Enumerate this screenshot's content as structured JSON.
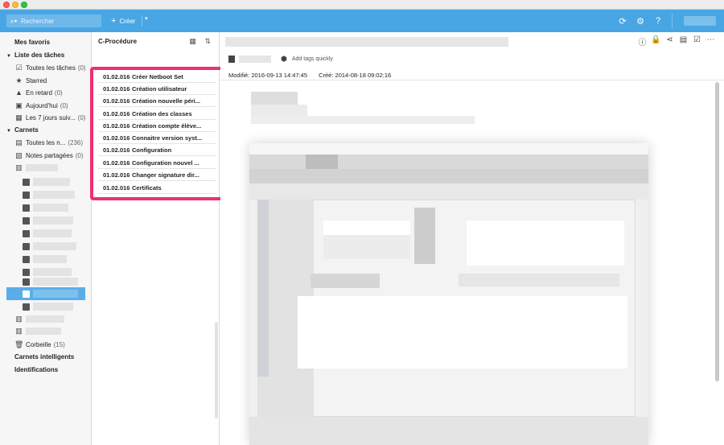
{
  "search": {
    "placeholder": "Rechercher"
  },
  "toolbar": {
    "create_label": "Créer"
  },
  "sidebar": {
    "favorites": "Mes favoris",
    "tasks_header": "Liste des tâches",
    "tasks": [
      {
        "label": "Toutes les tâches",
        "count": "(0)"
      },
      {
        "label": "Starred",
        "count": ""
      },
      {
        "label": "En retard",
        "count": "(0)"
      },
      {
        "label": "Aujourd'hui",
        "count": "(0)"
      },
      {
        "label": "Les 7 jours suiv...",
        "count": "(0)"
      }
    ],
    "notebooks_header": "Carnets",
    "all_notes": {
      "label": "Toutes les n...",
      "count": "(236)"
    },
    "shared_notes": {
      "label": "Notes partagées",
      "count": "(0)"
    },
    "trash": {
      "label": "Corbeille",
      "count": "(15)"
    },
    "smart_notebooks": "Carnets intelligents",
    "identifications": "Identifications"
  },
  "notelist": {
    "title": "C-Procédure",
    "notes": [
      {
        "num": "01.02.016",
        "title": "Créer Netboot Set"
      },
      {
        "num": "01.02.016",
        "title": "Création utilisateur"
      },
      {
        "num": "01.02.016",
        "title": "Création nouvelle péri..."
      },
      {
        "num": "01.02.016",
        "title": "Création des classes"
      },
      {
        "num": "01.02.016",
        "title": "Création compte élève..."
      },
      {
        "num": "01.02.016",
        "title": "Connaitre version syst..."
      },
      {
        "num": "01.02.016",
        "title": "Configuration"
      },
      {
        "num": "01.02.016",
        "title": "Configuration nouvel ..."
      },
      {
        "num": "01.02.016",
        "title": "Changer signature dir..."
      },
      {
        "num": "01.02.016",
        "title": "Certificats"
      }
    ]
  },
  "note": {
    "add_tags": "Add tags quickly",
    "modified": "Modifié: 2016-09-13 14:47:45",
    "created": "Créé: 2014-08-18 09:02:16"
  }
}
